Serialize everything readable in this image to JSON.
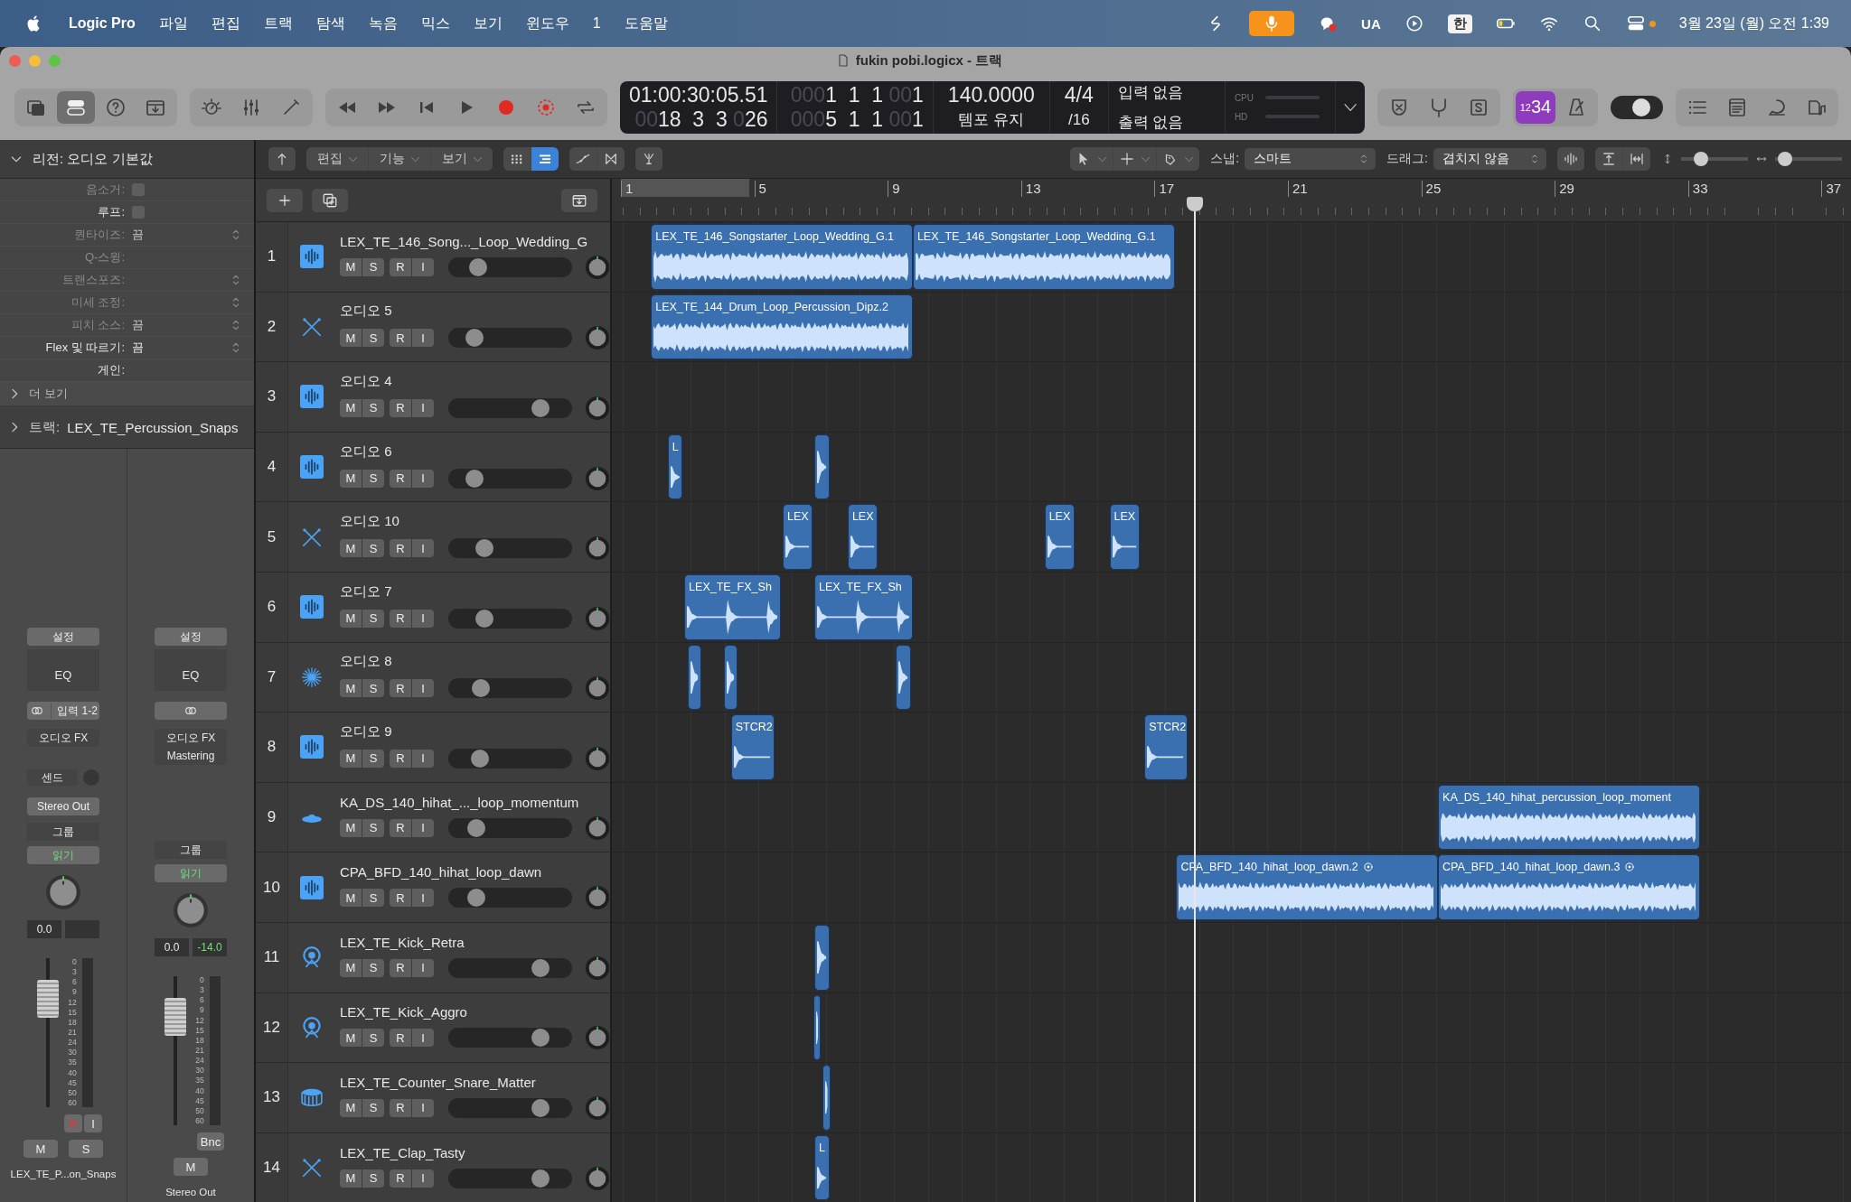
{
  "menubar": {
    "app": "Logic Pro",
    "menus": [
      "파일",
      "편집",
      "트랙",
      "탐색",
      "녹음",
      "믹스",
      "보기",
      "윈도우",
      "1",
      "도움말"
    ],
    "status": [
      {
        "kind": "scribble"
      },
      {
        "kind": "mic",
        "selected": true
      },
      {
        "kind": "chat"
      },
      {
        "kind": "text",
        "label": "UA"
      },
      {
        "kind": "playcircle"
      },
      {
        "kind": "input",
        "label": "한"
      },
      {
        "kind": "battery"
      },
      {
        "kind": "wifi"
      },
      {
        "kind": "search"
      },
      {
        "kind": "control"
      }
    ],
    "clock": "3월 23일 (월) 오전 1:39"
  },
  "window": {
    "title": "fukin pobi.logicx - 트랙"
  },
  "control_bar": {
    "groups": [
      [
        {
          "kind": "library",
          "selected": false
        },
        {
          "kind": "inspector",
          "selected": true
        },
        {
          "kind": "help",
          "selected": false
        },
        {
          "kind": "toolbar",
          "selected": false
        }
      ],
      [
        {
          "kind": "smart",
          "selected": false
        },
        {
          "kind": "mixer",
          "selected": false
        },
        {
          "kind": "pencil",
          "selected": false
        }
      ],
      [
        {
          "kind": "rewind",
          "selected": false
        },
        {
          "kind": "ff",
          "selected": false
        },
        {
          "kind": "tostart",
          "selected": false
        },
        {
          "kind": "play",
          "selected": false
        },
        {
          "kind": "record",
          "selected": false
        },
        {
          "kind": "capture",
          "selected": false
        },
        {
          "kind": "cycle",
          "selected": false
        }
      ]
    ],
    "lcd": [
      {
        "kind": "clock",
        "rows": [
          [
            {
              "text": "01:00:30:05.51",
              "dim": false
            }
          ],
          [
            {
              "text": "00",
              "dim": true
            },
            {
              "text": "18  3  3 ",
              "dim": false
            },
            {
              "text": "0",
              "dim": true
            },
            {
              "text": "26",
              "dim": false
            }
          ]
        ]
      },
      {
        "kind": "clock",
        "rows": [
          [
            {
              "text": "000",
              "dim": true
            },
            {
              "text": "1  1  1 ",
              "dim": false
            },
            {
              "text": "00",
              "dim": true
            },
            {
              "text": "1",
              "dim": false
            }
          ],
          [
            {
              "text": "000",
              "dim": true
            },
            {
              "text": "5  1  1 ",
              "dim": false
            },
            {
              "text": "00",
              "dim": true
            },
            {
              "text": "1",
              "dim": false
            }
          ]
        ]
      },
      {
        "kind": "tempo",
        "rows": [
          [
            {
              "text": "140.0000",
              "dim": false
            }
          ],
          [
            {
              "text": "템포 유지",
              "dim": false
            }
          ]
        ]
      },
      {
        "kind": "tempo",
        "rows": [
          [
            {
              "text": "4/4",
              "dim": false
            }
          ],
          [
            {
              "text": "/16",
              "dim": false
            }
          ]
        ]
      },
      {
        "kind": "io",
        "rows": [
          [
            {
              "text": "입력 없음",
              "dim": false
            }
          ],
          [
            {
              "text": "출력 없음",
              "dim": false
            }
          ]
        ]
      }
    ],
    "meters": [
      {
        "label": "CPU"
      },
      {
        "label": "HD"
      }
    ],
    "right_groups": [
      [
        {
          "kind": "xshield",
          "selected": false
        },
        {
          "kind": "tuner",
          "selected": false
        },
        {
          "kind": "solo",
          "selected": false
        }
      ],
      [
        {
          "kind": "countin",
          "label": "1234",
          "selected": true
        },
        {
          "kind": "metronome",
          "selected": false
        }
      ]
    ],
    "switch": {
      "on": true
    },
    "browser_buttons": [
      {
        "kind": "list",
        "selected": false
      },
      {
        "kind": "notepad",
        "selected": false
      },
      {
        "kind": "loops",
        "selected": false
      },
      {
        "kind": "browser",
        "selected": false
      }
    ]
  },
  "inspector": {
    "header": "리전: 오디오 기본값",
    "rows": [
      {
        "label": "음소거:",
        "kind": "checkbox",
        "checked": false,
        "disabled": true
      },
      {
        "label": "루프:",
        "kind": "checkbox",
        "checked": false,
        "disabled": false
      },
      {
        "label": "퀀타이즈:",
        "value": "끔",
        "kind": "stepper",
        "disabled": true
      },
      {
        "label": "Q-스윙:",
        "kind": "text",
        "disabled": true
      },
      {
        "label": "트랜스포즈:",
        "kind": "stepper",
        "disabled": true
      },
      {
        "label": "미세 조정:",
        "kind": "stepper",
        "disabled": true
      },
      {
        "label": "피치 소스:",
        "value": "끔",
        "kind": "stepper",
        "disabled": true
      },
      {
        "label": "Flex 및 따르기:",
        "value": "끔",
        "kind": "stepper",
        "disabled": false
      },
      {
        "label": "게인:",
        "kind": "text",
        "disabled": false
      }
    ],
    "more": "더 보기",
    "track_label": "트랙:",
    "track_name": "LEX_TE_Percussion_Snaps",
    "strips": [
      {
        "setting": "설정",
        "eq": "EQ",
        "input": "입력 1-2",
        "fx": [
          "오디오 FX"
        ],
        "send": "센드",
        "output": "Stereo Out",
        "group": "그룹",
        "automation": "읽기",
        "gain": "0.0",
        "fader": {
          "level": 0.78
        },
        "scale": [
          "0",
          "3",
          "6",
          "9",
          "12",
          "15",
          "18",
          "21",
          "24",
          "30",
          "35",
          "40",
          "45",
          "50",
          "60"
        ],
        "buttons": [
          {
            "label": "R",
            "kind": "record"
          },
          {
            "label": "I",
            "kind": "plain"
          }
        ],
        "mutes": [
          "M",
          "S"
        ],
        "name": "LEX_TE_P...on_Snaps"
      },
      {
        "setting": "설정",
        "eq": "EQ",
        "fx": [
          "오디오 FX",
          "Mastering"
        ],
        "group": "그룹",
        "automation": "읽기",
        "gain": "0.0",
        "peak": "-14.0",
        "fader": {
          "level": 0.78
        },
        "scale": [
          "0",
          "3",
          "6",
          "9",
          "12",
          "15",
          "18",
          "21",
          "24",
          "30",
          "35",
          "40",
          "45",
          "50",
          "60"
        ],
        "buttons": [
          {
            "label": "Bnc",
            "kind": "plain"
          }
        ],
        "mutes": [
          "M"
        ],
        "name": "Stereo Out"
      }
    ]
  },
  "editor_toolbar": {
    "menus": [
      "편집",
      "기능",
      "보기"
    ],
    "views": [
      {
        "kind": "grid",
        "selected": false
      },
      {
        "kind": "lines",
        "selected": true
      }
    ],
    "snap_label": "스냅:",
    "snap": "스마트",
    "drag_label": "드래그:",
    "drag": "겹치지 않음",
    "vzoom": {
      "level": 0.3
    },
    "hzoom": {
      "level": 0.15
    }
  },
  "ruler": {
    "marks": [
      "1",
      "5",
      "9",
      "13",
      "17",
      "21",
      "25",
      "29",
      "33",
      "37"
    ],
    "cycle": {
      "on": false
    }
  },
  "tracks": [
    {
      "number": "1",
      "name": "LEX_TE_146_Song..._Loop_Wedding_G",
      "kind": "waveform",
      "controls": [
        "M",
        "S",
        "R",
        "I"
      ],
      "level": 0.25,
      "regions": [
        {
          "name": "LEX_TE_146_Songstarter_Loop_Wedding_G.1"
        },
        {
          "name": "LEX_TE_146_Songstarter_Loop_Wedding_G.1"
        }
      ]
    },
    {
      "number": "2",
      "name": "오디오 5",
      "kind": "sticks",
      "controls": [
        "M",
        "S",
        "R",
        "I"
      ],
      "level": 0.22,
      "regions": [
        {
          "name": "LEX_TE_144_Drum_Loop_Percussion_Dipz.2"
        }
      ]
    },
    {
      "number": "3",
      "name": "오디오 4",
      "kind": "waveform",
      "controls": [
        "M",
        "S",
        "R",
        "I"
      ],
      "level": 0.75
    },
    {
      "number": "4",
      "name": "오디오 6",
      "kind": "waveform",
      "controls": [
        "M",
        "S",
        "R",
        "I"
      ],
      "level": 0.22,
      "regions": [
        {
          "name": "L"
        },
        {
          "kind": "region"
        }
      ]
    },
    {
      "number": "5",
      "name": "오디오 10",
      "kind": "sticks",
      "controls": [
        "M",
        "S",
        "R",
        "I"
      ],
      "level": 0.3,
      "regions": [
        {
          "name": "LEX"
        },
        {
          "name": "LEX"
        },
        {
          "name": "LEX"
        },
        {
          "name": "LEX"
        }
      ]
    },
    {
      "number": "6",
      "name": "오디오 7",
      "kind": "waveform",
      "controls": [
        "M",
        "S",
        "R",
        "I"
      ],
      "level": 0.3,
      "regions": [
        {
          "name": "LEX_TE_FX_Sh"
        },
        {
          "name": "LEX_TE_FX_Sh"
        }
      ]
    },
    {
      "number": "7",
      "name": "오디오 8",
      "kind": "burst",
      "controls": [
        "M",
        "S",
        "R",
        "I"
      ],
      "level": 0.27,
      "regions": [
        {
          "kind": "region"
        },
        {
          "kind": "region"
        },
        {
          "kind": "region"
        }
      ]
    },
    {
      "number": "8",
      "name": "오디오 9",
      "kind": "waveform",
      "controls": [
        "M",
        "S",
        "R",
        "I"
      ],
      "level": 0.26,
      "regions": [
        {
          "name": "STCR2"
        },
        {
          "name": "STCR2"
        }
      ]
    },
    {
      "number": "9",
      "name": "KA_DS_140_hihat_..._loop_momentum",
      "kind": "cymbal",
      "controls": [
        "M",
        "S",
        "R",
        "I"
      ],
      "level": 0.23,
      "regions": [
        {
          "name": "KA_DS_140_hihat_percussion_loop_moment"
        }
      ]
    },
    {
      "number": "10",
      "name": "CPA_BFD_140_hihat_loop_dawn",
      "kind": "waveform",
      "controls": [
        "M",
        "S",
        "R",
        "I"
      ],
      "level": 0.23,
      "regions": [
        {
          "name": "CPA_BFD_140_hihat_loop_dawn.2",
          "looped": true
        },
        {
          "name": "CPA_BFD_140_hihat_loop_dawn.3",
          "looped": true
        }
      ]
    },
    {
      "number": "11",
      "name": "LEX_TE_Kick_Retra",
      "kind": "kick",
      "controls": [
        "M",
        "S",
        "R",
        "I"
      ],
      "level": 0.75,
      "regions": [
        {
          "kind": "region"
        }
      ]
    },
    {
      "number": "12",
      "name": "LEX_TE_Kick_Aggro",
      "kind": "kick",
      "controls": [
        "M",
        "S",
        "R",
        "I"
      ],
      "level": 0.75,
      "regions": [
        {
          "kind": "region"
        }
      ]
    },
    {
      "number": "13",
      "name": "LEX_TE_Counter_Snare_Matter",
      "kind": "snare",
      "controls": [
        "M",
        "S",
        "R",
        "I"
      ],
      "level": 0.75,
      "regions": [
        {
          "kind": "region"
        }
      ]
    },
    {
      "number": "14",
      "name": "LEX_TE_Clap_Tasty",
      "kind": "sticks",
      "controls": [
        "M",
        "S",
        "R",
        "I"
      ],
      "level": 0.75,
      "regions": [
        {
          "name": "L"
        }
      ]
    }
  ]
}
